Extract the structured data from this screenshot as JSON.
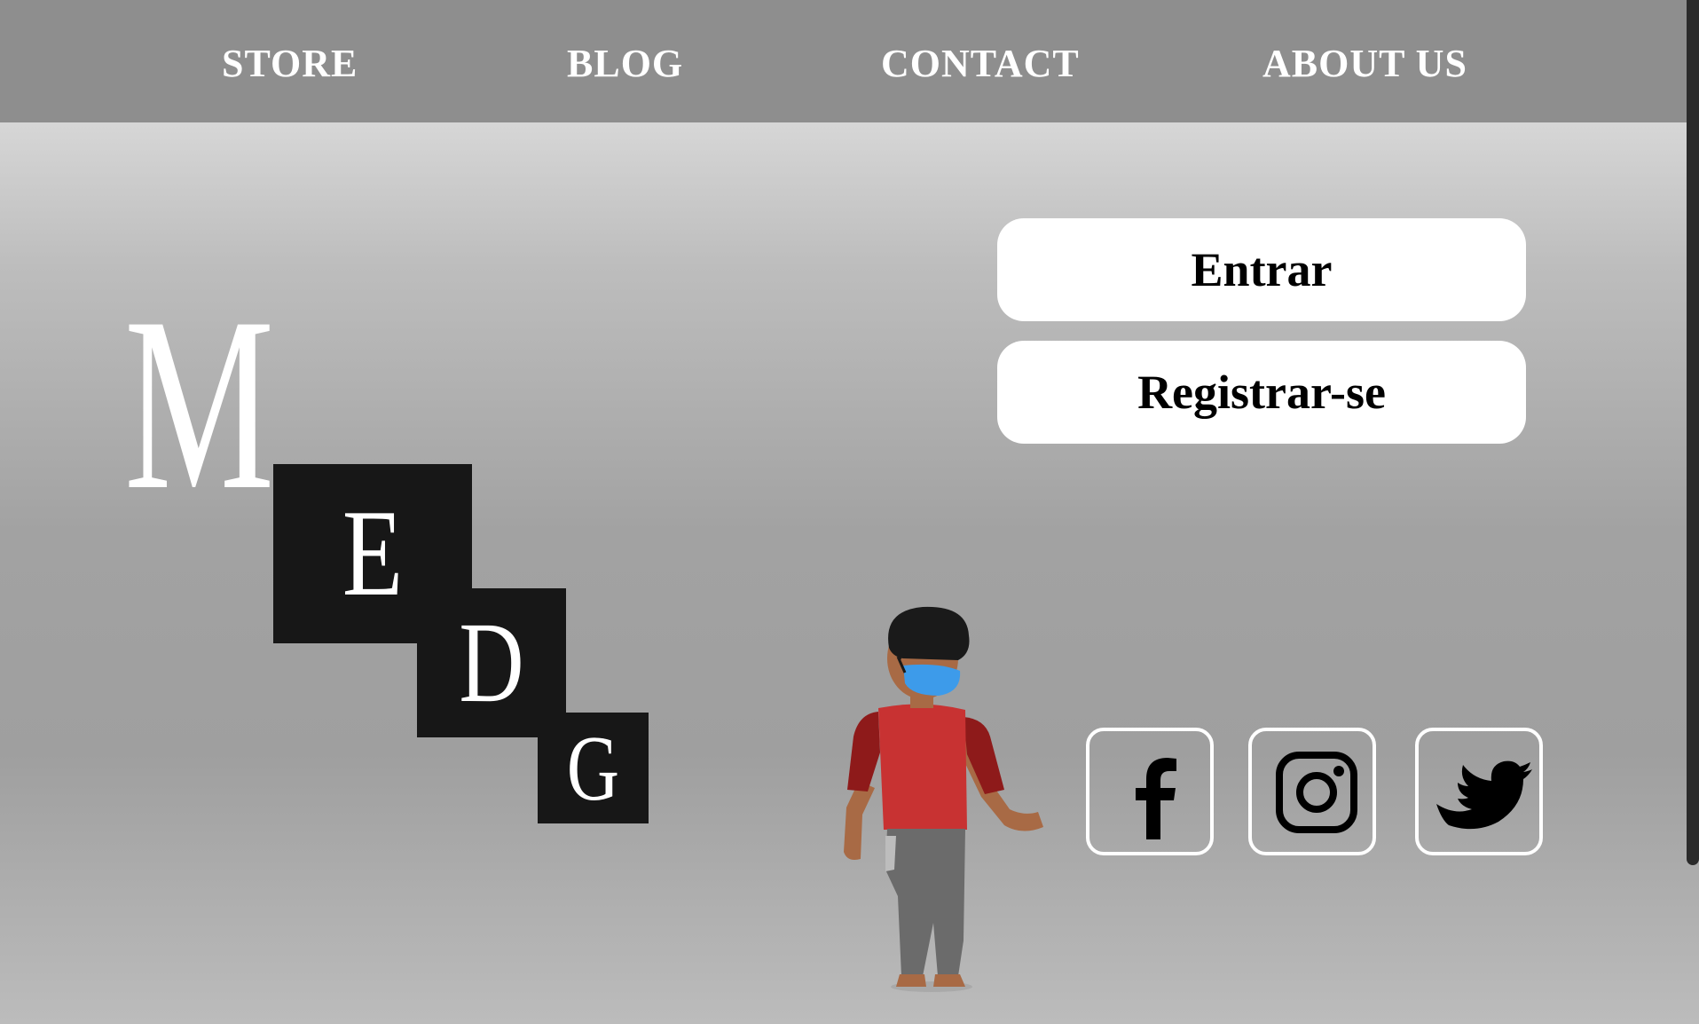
{
  "nav": {
    "items": [
      {
        "label": "STORE"
      },
      {
        "label": "BLOG"
      },
      {
        "label": "CONTACT"
      },
      {
        "label": "ABOUT US"
      }
    ]
  },
  "logo": {
    "letters": [
      "M",
      "E",
      "D",
      "G"
    ]
  },
  "auth": {
    "login_label": "Entrar",
    "register_label": "Registrar-se"
  },
  "social": {
    "icons": [
      "facebook-icon",
      "instagram-icon",
      "twitter-icon"
    ]
  },
  "colors": {
    "nav_background": "#8e8e8e",
    "logo_tile": "#171717",
    "button_background": "#ffffff",
    "shirt": "#c83232",
    "mask": "#3d9bea"
  }
}
